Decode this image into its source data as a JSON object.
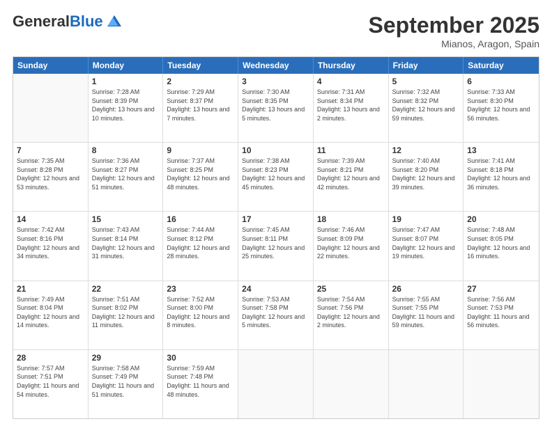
{
  "header": {
    "logo_general": "General",
    "logo_blue": "Blue",
    "month_title": "September 2025",
    "location": "Mianos, Aragon, Spain"
  },
  "weekdays": [
    "Sunday",
    "Monday",
    "Tuesday",
    "Wednesday",
    "Thursday",
    "Friday",
    "Saturday"
  ],
  "weeks": [
    [
      {
        "day": "",
        "empty": true
      },
      {
        "day": "1",
        "sunrise": "Sunrise: 7:28 AM",
        "sunset": "Sunset: 8:39 PM",
        "daylight": "Daylight: 13 hours and 10 minutes."
      },
      {
        "day": "2",
        "sunrise": "Sunrise: 7:29 AM",
        "sunset": "Sunset: 8:37 PM",
        "daylight": "Daylight: 13 hours and 7 minutes."
      },
      {
        "day": "3",
        "sunrise": "Sunrise: 7:30 AM",
        "sunset": "Sunset: 8:35 PM",
        "daylight": "Daylight: 13 hours and 5 minutes."
      },
      {
        "day": "4",
        "sunrise": "Sunrise: 7:31 AM",
        "sunset": "Sunset: 8:34 PM",
        "daylight": "Daylight: 13 hours and 2 minutes."
      },
      {
        "day": "5",
        "sunrise": "Sunrise: 7:32 AM",
        "sunset": "Sunset: 8:32 PM",
        "daylight": "Daylight: 12 hours and 59 minutes."
      },
      {
        "day": "6",
        "sunrise": "Sunrise: 7:33 AM",
        "sunset": "Sunset: 8:30 PM",
        "daylight": "Daylight: 12 hours and 56 minutes."
      }
    ],
    [
      {
        "day": "7",
        "sunrise": "Sunrise: 7:35 AM",
        "sunset": "Sunset: 8:28 PM",
        "daylight": "Daylight: 12 hours and 53 minutes."
      },
      {
        "day": "8",
        "sunrise": "Sunrise: 7:36 AM",
        "sunset": "Sunset: 8:27 PM",
        "daylight": "Daylight: 12 hours and 51 minutes."
      },
      {
        "day": "9",
        "sunrise": "Sunrise: 7:37 AM",
        "sunset": "Sunset: 8:25 PM",
        "daylight": "Daylight: 12 hours and 48 minutes."
      },
      {
        "day": "10",
        "sunrise": "Sunrise: 7:38 AM",
        "sunset": "Sunset: 8:23 PM",
        "daylight": "Daylight: 12 hours and 45 minutes."
      },
      {
        "day": "11",
        "sunrise": "Sunrise: 7:39 AM",
        "sunset": "Sunset: 8:21 PM",
        "daylight": "Daylight: 12 hours and 42 minutes."
      },
      {
        "day": "12",
        "sunrise": "Sunrise: 7:40 AM",
        "sunset": "Sunset: 8:20 PM",
        "daylight": "Daylight: 12 hours and 39 minutes."
      },
      {
        "day": "13",
        "sunrise": "Sunrise: 7:41 AM",
        "sunset": "Sunset: 8:18 PM",
        "daylight": "Daylight: 12 hours and 36 minutes."
      }
    ],
    [
      {
        "day": "14",
        "sunrise": "Sunrise: 7:42 AM",
        "sunset": "Sunset: 8:16 PM",
        "daylight": "Daylight: 12 hours and 34 minutes."
      },
      {
        "day": "15",
        "sunrise": "Sunrise: 7:43 AM",
        "sunset": "Sunset: 8:14 PM",
        "daylight": "Daylight: 12 hours and 31 minutes."
      },
      {
        "day": "16",
        "sunrise": "Sunrise: 7:44 AM",
        "sunset": "Sunset: 8:12 PM",
        "daylight": "Daylight: 12 hours and 28 minutes."
      },
      {
        "day": "17",
        "sunrise": "Sunrise: 7:45 AM",
        "sunset": "Sunset: 8:11 PM",
        "daylight": "Daylight: 12 hours and 25 minutes."
      },
      {
        "day": "18",
        "sunrise": "Sunrise: 7:46 AM",
        "sunset": "Sunset: 8:09 PM",
        "daylight": "Daylight: 12 hours and 22 minutes."
      },
      {
        "day": "19",
        "sunrise": "Sunrise: 7:47 AM",
        "sunset": "Sunset: 8:07 PM",
        "daylight": "Daylight: 12 hours and 19 minutes."
      },
      {
        "day": "20",
        "sunrise": "Sunrise: 7:48 AM",
        "sunset": "Sunset: 8:05 PM",
        "daylight": "Daylight: 12 hours and 16 minutes."
      }
    ],
    [
      {
        "day": "21",
        "sunrise": "Sunrise: 7:49 AM",
        "sunset": "Sunset: 8:04 PM",
        "daylight": "Daylight: 12 hours and 14 minutes."
      },
      {
        "day": "22",
        "sunrise": "Sunrise: 7:51 AM",
        "sunset": "Sunset: 8:02 PM",
        "daylight": "Daylight: 12 hours and 11 minutes."
      },
      {
        "day": "23",
        "sunrise": "Sunrise: 7:52 AM",
        "sunset": "Sunset: 8:00 PM",
        "daylight": "Daylight: 12 hours and 8 minutes."
      },
      {
        "day": "24",
        "sunrise": "Sunrise: 7:53 AM",
        "sunset": "Sunset: 7:58 PM",
        "daylight": "Daylight: 12 hours and 5 minutes."
      },
      {
        "day": "25",
        "sunrise": "Sunrise: 7:54 AM",
        "sunset": "Sunset: 7:56 PM",
        "daylight": "Daylight: 12 hours and 2 minutes."
      },
      {
        "day": "26",
        "sunrise": "Sunrise: 7:55 AM",
        "sunset": "Sunset: 7:55 PM",
        "daylight": "Daylight: 11 hours and 59 minutes."
      },
      {
        "day": "27",
        "sunrise": "Sunrise: 7:56 AM",
        "sunset": "Sunset: 7:53 PM",
        "daylight": "Daylight: 11 hours and 56 minutes."
      }
    ],
    [
      {
        "day": "28",
        "sunrise": "Sunrise: 7:57 AM",
        "sunset": "Sunset: 7:51 PM",
        "daylight": "Daylight: 11 hours and 54 minutes."
      },
      {
        "day": "29",
        "sunrise": "Sunrise: 7:58 AM",
        "sunset": "Sunset: 7:49 PM",
        "daylight": "Daylight: 11 hours and 51 minutes."
      },
      {
        "day": "30",
        "sunrise": "Sunrise: 7:59 AM",
        "sunset": "Sunset: 7:48 PM",
        "daylight": "Daylight: 11 hours and 48 minutes."
      },
      {
        "day": "",
        "empty": true
      },
      {
        "day": "",
        "empty": true
      },
      {
        "day": "",
        "empty": true
      },
      {
        "day": "",
        "empty": true
      }
    ]
  ]
}
